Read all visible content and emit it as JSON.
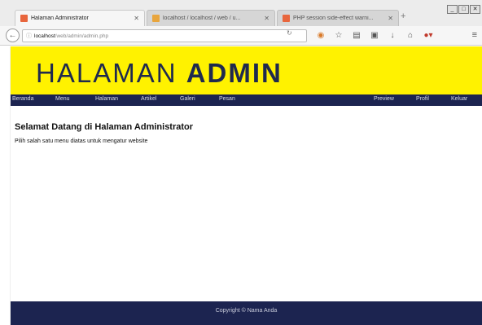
{
  "browser": {
    "tabs": [
      {
        "label": "Halaman Administrator",
        "active": true,
        "favicon_color": "#e8663d"
      },
      {
        "label": "localhost / localhost / web / u...",
        "active": false,
        "favicon_color": "#e8a53d"
      },
      {
        "label": "PHP session side-effect warni...",
        "active": false,
        "favicon_color": "#e8663d"
      }
    ],
    "tab_close": "✕",
    "new_tab": "+",
    "window_controls": [
      "_",
      "□",
      "✕"
    ],
    "url_host": "localhost",
    "url_path": "/web/admin/admin.php",
    "toolbar_icons": [
      "reload-icon",
      "pocket-icon",
      "star-icon",
      "reader-icon",
      "pocket-save-icon",
      "download-icon",
      "home-icon",
      "addon-icon",
      "menu-icon"
    ]
  },
  "site": {
    "title_light": "HALAMAN ",
    "title_bold": "ADMIN",
    "nav_left": [
      "Beranda",
      "Menu",
      "Halaman",
      "Artikel",
      "Galeri",
      "Pesan"
    ],
    "nav_right": [
      "Preview",
      "Profil",
      "Keluar"
    ],
    "welcome": "Selamat Datang di Halaman Administrator",
    "instruction": "Pilih salah satu menu diatas untuk mengatur website",
    "footer": "Copyright © Nama Anda",
    "colors": {
      "header_bg": "#fff200",
      "nav_bg": "#1c2450",
      "title_color": "#1f2a4e"
    }
  }
}
